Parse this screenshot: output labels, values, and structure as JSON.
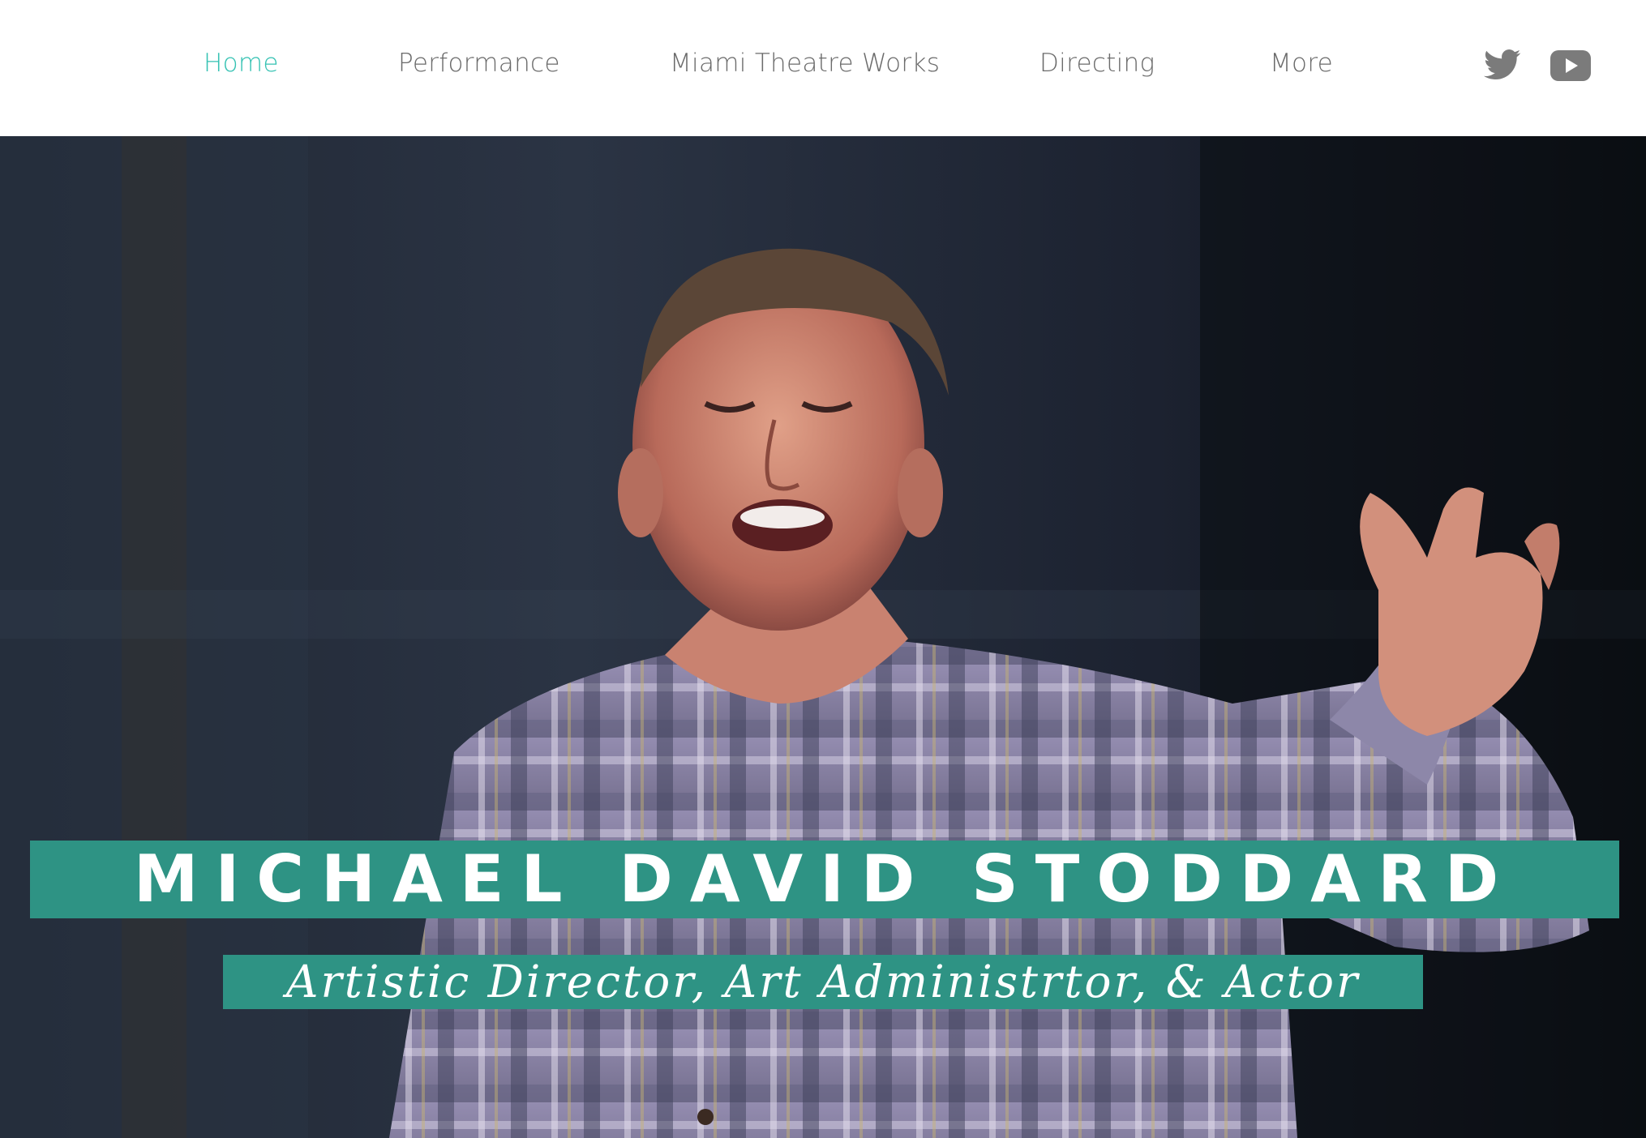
{
  "nav": {
    "items": [
      {
        "label": "Home",
        "active": true
      },
      {
        "label": "Performance",
        "active": false
      },
      {
        "label": "Miami Theatre Works",
        "active": false
      },
      {
        "label": "Directing",
        "active": false
      },
      {
        "label": "More",
        "active": false
      }
    ],
    "active_color": "#35c2b3",
    "inactive_color": "#6b6b6b"
  },
  "social": {
    "icons": [
      "twitter-icon",
      "youtube-icon"
    ],
    "icon_color": "#7b7b7b"
  },
  "hero": {
    "name": "MICHAEL DAVID STODDARD",
    "subtitle": "Artistic Director, Art Administrtor, & Actor",
    "band_color": "#2e9384",
    "photo_description_icon": "performer-photo"
  }
}
